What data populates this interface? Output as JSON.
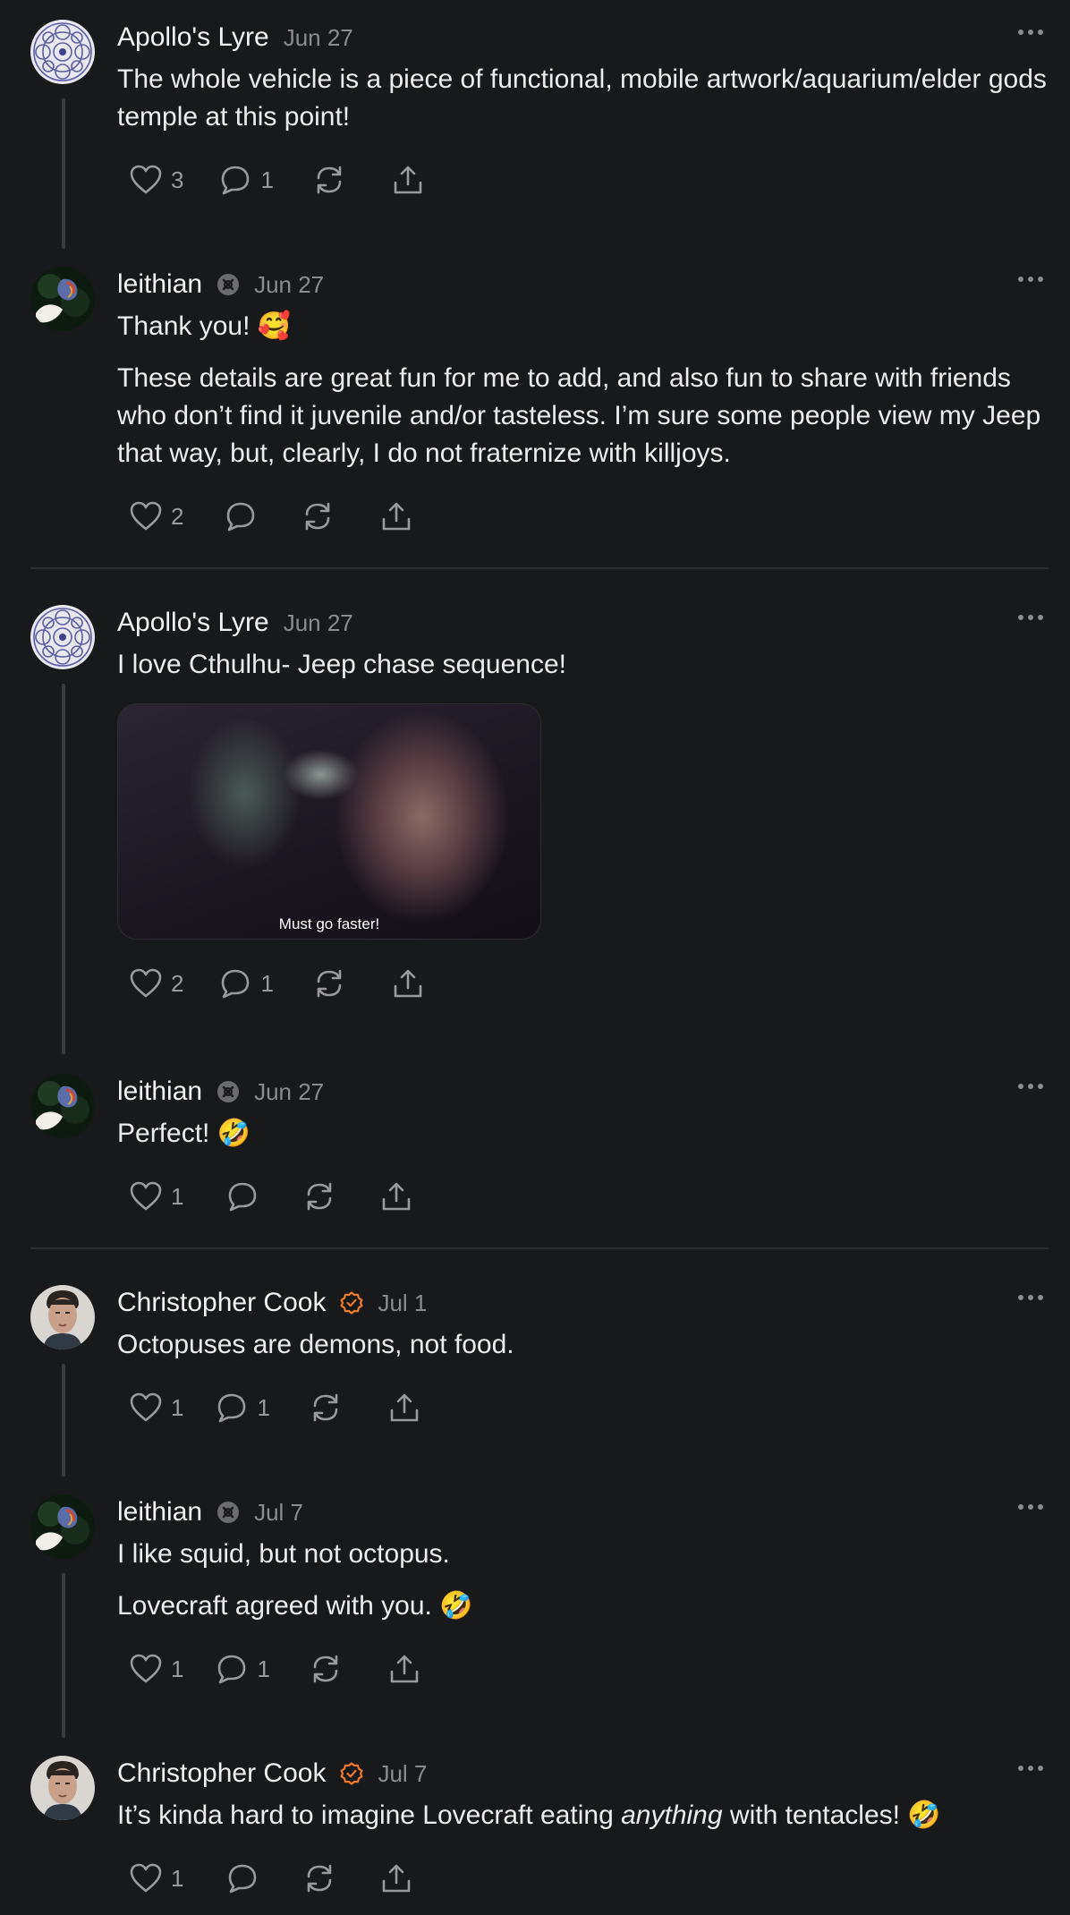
{
  "comments": [
    {
      "author": "Apollo's Lyre",
      "date": "Jun 27",
      "paragraphs": [
        "The whole vehicle is a piece of functional, mobile artwork/aquarium/elder gods temple at this point!"
      ],
      "likes": "3",
      "replies": "1"
    },
    {
      "author": "leithian",
      "date": "Jun 27",
      "paragraphs": [
        "Thank you! 🥰",
        "These details are great fun for me to add, and also fun to share with friends who don’t find it juvenile and/or tasteless. I’m sure some people view my Jeep that way, but, clearly, I do not fraternize with killjoys."
      ],
      "likes": "2",
      "replies": ""
    },
    {
      "author": "Apollo's Lyre",
      "date": "Jun 27",
      "paragraphs": [
        "I love Cthulhu- Jeep chase sequence!"
      ],
      "media_caption": "Must go faster!",
      "likes": "2",
      "replies": "1"
    },
    {
      "author": "leithian",
      "date": "Jun 27",
      "paragraphs": [
        "Perfect! 🤣"
      ],
      "likes": "1",
      "replies": ""
    },
    {
      "author": "Christopher Cook",
      "date": "Jul 1",
      "paragraphs": [
        "Octopuses are demons, not food."
      ],
      "likes": "1",
      "replies": "1"
    },
    {
      "author": "leithian",
      "date": "Jul 7",
      "paragraphs": [
        "I like squid, but not octopus.",
        "Lovecraft agreed with you. 🤣"
      ],
      "likes": "1",
      "replies": "1"
    },
    {
      "author": "Christopher Cook",
      "date": "Jul 7",
      "text_before": "It’s kinda hard to imagine Lovecraft eating ",
      "text_italic": "anything",
      "text_after": " with tentacles! 🤣",
      "likes": "1",
      "replies": ""
    }
  ],
  "colors": {
    "background": "#18191b",
    "text": "#ececec",
    "muted": "#8c8c90",
    "verified_badge": "#f07a2a",
    "thread_line": "#3a3b3e"
  },
  "icons": [
    "heart-icon",
    "comment-icon",
    "restack-icon",
    "share-icon",
    "more-icon",
    "verified-icon",
    "founding-badge-icon"
  ]
}
